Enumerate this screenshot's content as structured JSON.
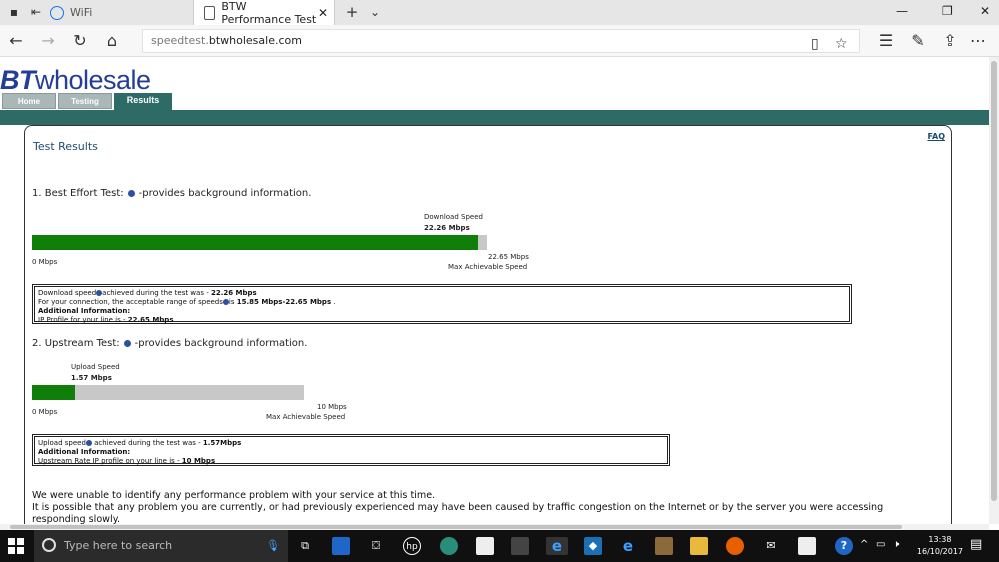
{
  "browser": {
    "tabs": [
      {
        "label": "WiFi"
      },
      {
        "label": "BTW Performance Test"
      }
    ],
    "url_host": "speedtest.",
    "url_domain": "btwholesale.com"
  },
  "site": {
    "logo_bt": "BT",
    "logo_rest": "wholesale",
    "nav": [
      "Home",
      "Testing",
      "Results"
    ],
    "faq": "FAQ"
  },
  "results": {
    "title": "Test Results",
    "section1_prefix": "1. Best Effort Test:",
    "section1_suffix": "-provides background information.",
    "download": {
      "label": "Download Speed",
      "value": "22.26 Mbps",
      "min_label": "0 Mbps",
      "max_value": "22.65 Mbps",
      "max_label": "Max Achievable Speed",
      "fill_fraction": 0.98
    },
    "download_info": {
      "line1_a": "Download speed",
      "line1_b": "achieved during the test was - ",
      "line1_v": "22.26 Mbps",
      "line2_a": "For your connection, the acceptable range of speeds",
      "line2_b": "is ",
      "line2_v": "15.85 Mbps-22.65 Mbps",
      "line2_c": " .",
      "line3": "Additional Information:",
      "line4_a": "IP Profile for your line is - ",
      "line4_v": "22.65 Mbps"
    },
    "section2_prefix": "2. Upstream Test:",
    "section2_suffix": "-provides background information.",
    "upload": {
      "label": "Upload Speed",
      "value": "1.57 Mbps",
      "min_label": "0 Mbps",
      "max_value": "10 Mbps",
      "max_label": "Max Achievable Speed",
      "fill_fraction": 0.157
    },
    "upload_info": {
      "line1_a": "Upload speed",
      "line1_b": " achieved during the test was - ",
      "line1_v": "1.57Mbps",
      "line2": "Additional Information:",
      "line3_a": "Upstream Rate IP profile on your line is - ",
      "line3_v": "10 Mbps"
    },
    "conclusion1": "We were unable to identify any performance problem with your service at this time.",
    "conclusion2": "It is possible that any problem you are currently, or had previously experienced may have been caused by traffic congestion on the Internet or by the server you were accessing responding slowly."
  },
  "taskbar": {
    "search_placeholder": "Type here to search",
    "time": "13:38",
    "date": "16/10/2017"
  }
}
